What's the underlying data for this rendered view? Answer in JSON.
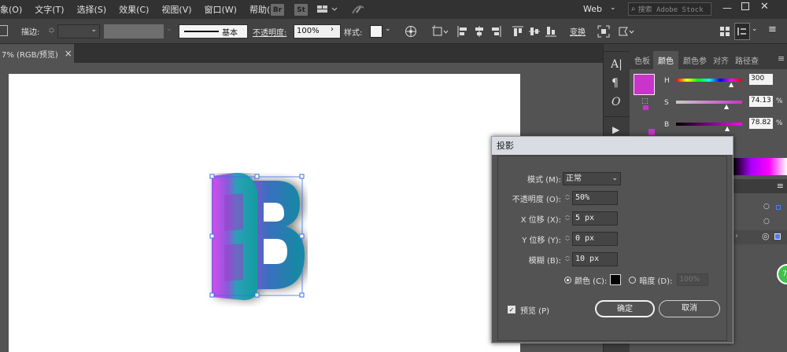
{
  "menubar": {
    "items": [
      "象(O)",
      "文字(T)",
      "选择(S)",
      "效果(C)",
      "视图(V)",
      "窗口(W)",
      "帮助(H)"
    ],
    "bridge_label": "Br",
    "stock_label": "St",
    "workspace": "Web",
    "search_placeholder": "搜索 Adobe Stock"
  },
  "control": {
    "stroke_label": "描边:",
    "stroke_style": "基本",
    "opacity_label": "不透明度:",
    "opacity_value": "100%",
    "style_label": "样式:",
    "transform_label": "变换"
  },
  "document": {
    "tab_label": "7% (RGB/预览)",
    "close": "×"
  },
  "color_panel": {
    "tabs": [
      "色板",
      "颜色",
      "颜色参",
      "对齐",
      "路径查"
    ],
    "h_label": "H",
    "h_value": "300",
    "s_label": "S",
    "s_value": "74.13",
    "b_label": "B",
    "b_value": "78.82",
    "percent": "%",
    "fill_color": "#c934c9"
  },
  "dialog": {
    "title": "投影",
    "mode_label": "模式 (M):",
    "mode_value": "正常",
    "opacity_label": "不透明度 (O):",
    "opacity_value": "50%",
    "x_label": "X 位移 (X):",
    "x_value": "5 px",
    "y_label": "Y 位移 (Y):",
    "y_value": "0 px",
    "blur_label": "模糊 (B):",
    "blur_value": "10 px",
    "color_option": "颜色 (C):",
    "darkness_option": "暗度 (D):",
    "darkness_value": "100%",
    "preview_label": "预览 (P)",
    "ok_label": "确定",
    "cancel_label": "取消"
  },
  "canvas": {
    "letter": "B"
  },
  "badge": {
    "label": "77"
  }
}
